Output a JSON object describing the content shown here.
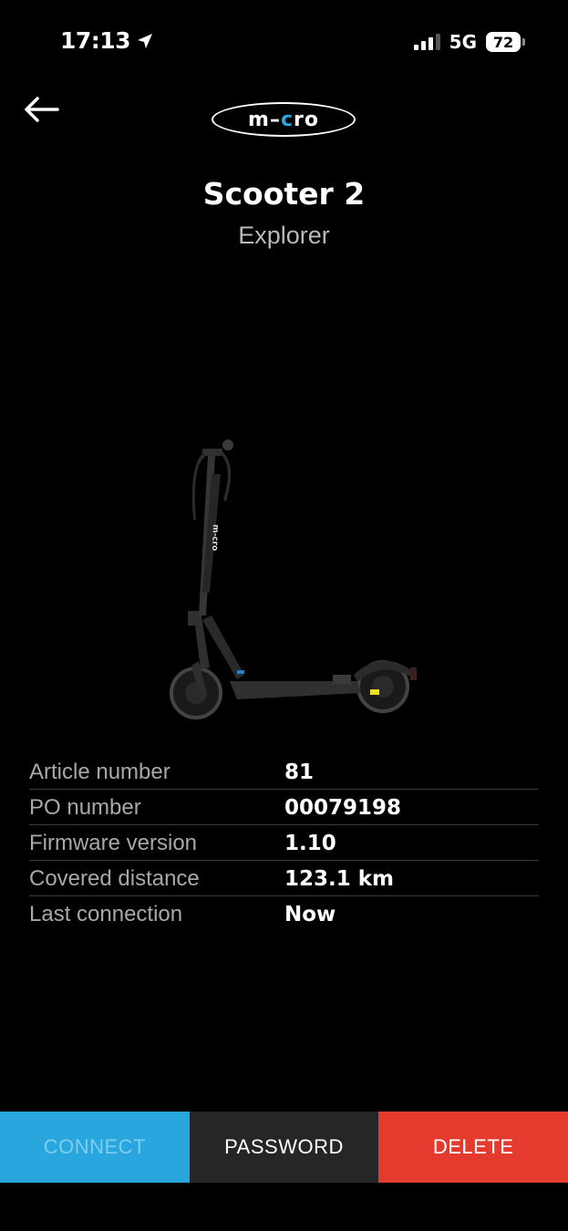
{
  "status_bar": {
    "time": "17:13",
    "network": "5G",
    "battery": "72"
  },
  "header": {
    "logo_text_left": "m",
    "logo_text_dash": "–",
    "logo_text_dot": "c",
    "logo_text_right": "ro"
  },
  "device": {
    "name": "Scooter 2",
    "model": "Explorer",
    "image_brand": "m-cro"
  },
  "info": [
    {
      "label": "Article number",
      "value": "81"
    },
    {
      "label": "PO number",
      "value": "00079198"
    },
    {
      "label": "Firmware version",
      "value": "1.10"
    },
    {
      "label": "Covered distance",
      "value": "123.1 km"
    },
    {
      "label": "Last connection",
      "value": "Now"
    }
  ],
  "actions": {
    "connect": "CONNECT",
    "password": "PASSWORD",
    "delete": "DELETE"
  },
  "colors": {
    "background": "#000000",
    "connect": "#29a6de",
    "password": "#262626",
    "delete": "#e53b2e"
  }
}
